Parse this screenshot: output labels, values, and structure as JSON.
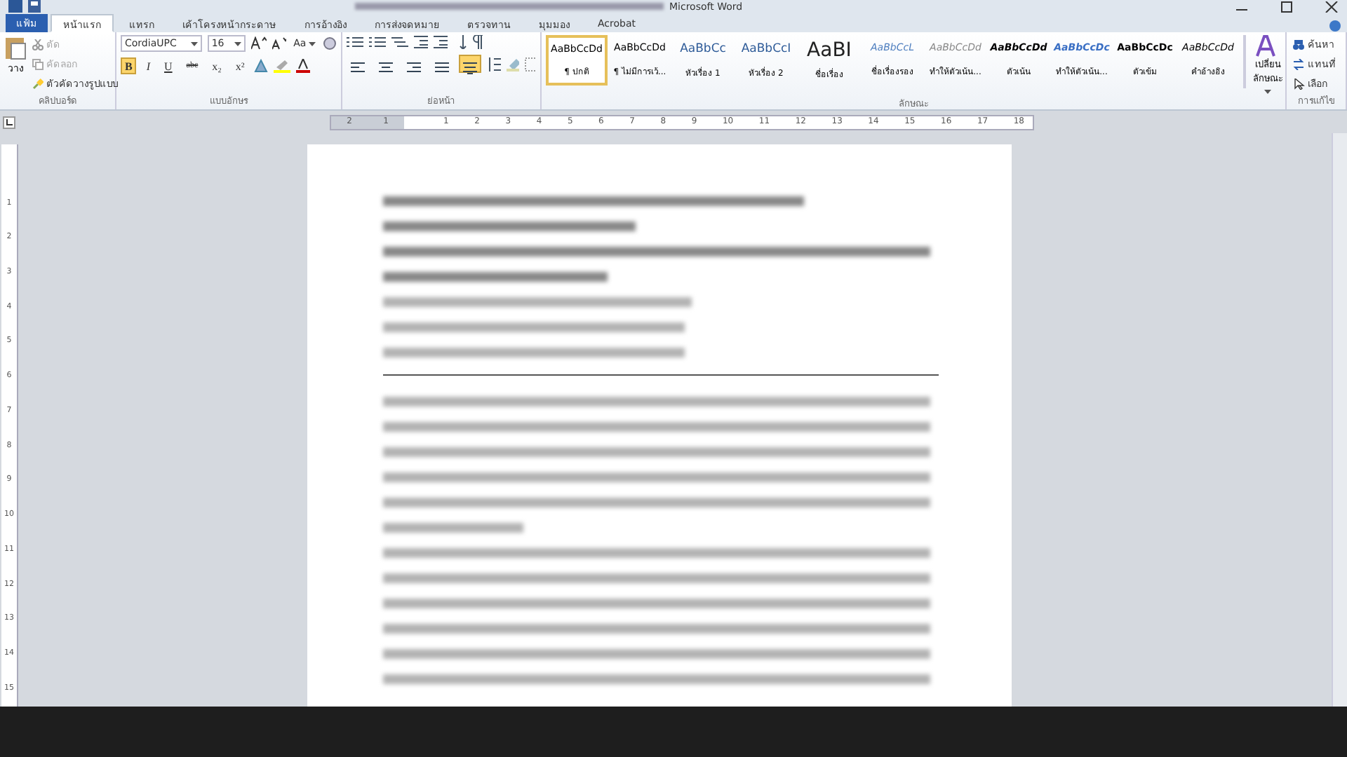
{
  "window": {
    "title": "Microsoft Word"
  },
  "file_tab": {
    "label": "แฟ้ม"
  },
  "tabs": [
    {
      "label": "หน้าแรก",
      "selected": true
    },
    {
      "label": "แทรก",
      "selected": false
    },
    {
      "label": "เค้าโครงหน้ากระดาษ",
      "selected": false
    },
    {
      "label": "การอ้างอิง",
      "selected": false
    },
    {
      "label": "การส่งจดหมาย",
      "selected": false
    },
    {
      "label": "ตรวจทาน",
      "selected": false
    },
    {
      "label": "มุมมอง",
      "selected": false
    },
    {
      "label": "Acrobat",
      "selected": false
    }
  ],
  "clipboard": {
    "paste": "วาง",
    "cut": {
      "label": "ตัด",
      "disabled": true
    },
    "copy": {
      "label": "คัดลอก",
      "disabled": true
    },
    "format_painter": {
      "label": "ตัวคัดวางรูปแบบ",
      "disabled": false
    },
    "group_label": "คลิปบอร์ด"
  },
  "font": {
    "family": "CordiaUPC",
    "size": "16",
    "case_button": "Aa",
    "format_buttons": [
      {
        "label": "B",
        "kind": "bold",
        "selected": true
      },
      {
        "label": "I",
        "kind": "italic",
        "selected": false
      },
      {
        "label": "U",
        "kind": "underline",
        "selected": false
      },
      {
        "label": "abc",
        "kind": "strike",
        "selected": false
      },
      {
        "label": "x₂",
        "kind": "sub",
        "selected": false
      },
      {
        "label": "x²",
        "kind": "sup",
        "selected": false
      }
    ],
    "group_label": "แบบอักษร"
  },
  "paragraph": {
    "alignments": [
      {
        "kind": "left",
        "selected": false
      },
      {
        "kind": "center",
        "selected": false
      },
      {
        "kind": "right",
        "selected": false
      },
      {
        "kind": "justify",
        "selected": false
      },
      {
        "kind": "thai",
        "selected": true
      }
    ],
    "group_label": "ย่อหน้า"
  },
  "styles": {
    "items": [
      {
        "preview": "AaBbCcDd",
        "label": "¶ ปกติ",
        "kind": "normal",
        "selected": true
      },
      {
        "preview": "AaBbCcDd",
        "label": "¶ ไม่มีการเว้...",
        "kind": "normal",
        "selected": false
      },
      {
        "preview": "AaBbCc",
        "label": "หัวเรื่อง 1",
        "kind": "heading",
        "selected": false
      },
      {
        "preview": "AaBbCcI",
        "label": "หัวเรื่อง 2",
        "kind": "heading",
        "selected": false
      },
      {
        "preview": "AaBI",
        "label": "ชื่อเรื่อง",
        "kind": "title",
        "selected": false
      },
      {
        "preview": "AaBbCcL",
        "label": "ชื่อเรื่องรอง",
        "kind": "subtitle",
        "selected": false
      },
      {
        "preview": "AaBbCcDd",
        "label": "ทำให้ตัวเน้น...",
        "kind": "subtle",
        "selected": false
      },
      {
        "preview": "AaBbCcDd",
        "label": "ตัวเน้น",
        "kind": "emphasis",
        "selected": false
      },
      {
        "preview": "AaBbCcDc",
        "label": "ทำให้ตัวเน้น...",
        "kind": "intense",
        "selected": false
      },
      {
        "preview": "AaBbCcDc",
        "label": "ตัวเข้ม",
        "kind": "strong",
        "selected": false
      },
      {
        "preview": "AaBbCcDd",
        "label": "คำอ้างอิง",
        "kind": "quote",
        "selected": false
      }
    ],
    "change_styles": [
      "เปลี่ยน",
      "ลักษณะ"
    ],
    "group_label": "ลักษณะ"
  },
  "editing": {
    "items": [
      {
        "label": "ค้นหา",
        "kind": "find"
      },
      {
        "label": "แทนที่",
        "kind": "replace"
      },
      {
        "label": "เลือก",
        "kind": "select"
      }
    ],
    "group_label": "การแก้ไข"
  },
  "ruler": {
    "left_labels": [
      "2",
      "1"
    ],
    "labels": [
      "1",
      "2",
      "3",
      "4",
      "5",
      "6",
      "7",
      "8",
      "9",
      "10",
      "11",
      "12",
      "13",
      "14",
      "15",
      "16",
      "17",
      "18"
    ]
  },
  "vertical_ruler": {
    "labels": [
      "1",
      "2",
      "3",
      "4",
      "5",
      "6",
      "7",
      "8",
      "9",
      "10",
      "11",
      "12",
      "13",
      "14",
      "15"
    ]
  }
}
